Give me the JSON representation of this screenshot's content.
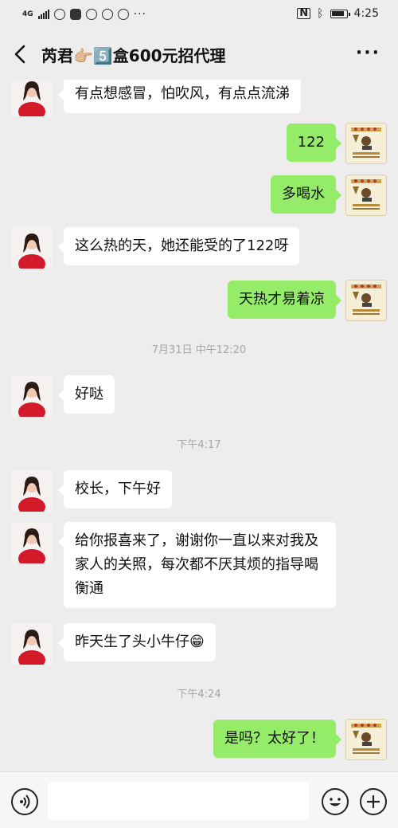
{
  "status_bar": {
    "network": "4G",
    "time": "4:25",
    "more": "···"
  },
  "header": {
    "title": "芮君👉🏼5️⃣盒600元招代理",
    "more": "···"
  },
  "messages": [
    {
      "side": "in",
      "text": "有点想感冒，怕吹风，有点点流涕"
    },
    {
      "side": "out",
      "text": "122"
    },
    {
      "side": "out",
      "text": "多喝水"
    },
    {
      "side": "in",
      "text": "这么热的天，她还能受的了122呀"
    },
    {
      "side": "out",
      "text": "天热才易着凉"
    },
    {
      "side": "time",
      "text": "7月31日 中午12:20"
    },
    {
      "side": "in",
      "text": "好哒"
    },
    {
      "side": "time",
      "text": "下午4:17"
    },
    {
      "side": "in",
      "text": "校长，下午好"
    },
    {
      "side": "in",
      "text": "给你报喜来了，谢谢你一直以来对我及家人的关照，每次都不厌其烦的指导喝衡通"
    },
    {
      "side": "in",
      "text": "昨天生了头小牛仔😁"
    },
    {
      "side": "time",
      "text": "下午4:24"
    },
    {
      "side": "out",
      "text": "是吗？太好了！"
    }
  ],
  "input_bar": {
    "voice_icon": "voice-icon",
    "emoji_icon": "emoji-icon",
    "plus_icon": "plus-icon"
  },
  "colors": {
    "background": "#ededed",
    "outgoing_bubble": "#95ec69",
    "incoming_bubble": "#ffffff",
    "timestamp": "#a6a6a6"
  }
}
